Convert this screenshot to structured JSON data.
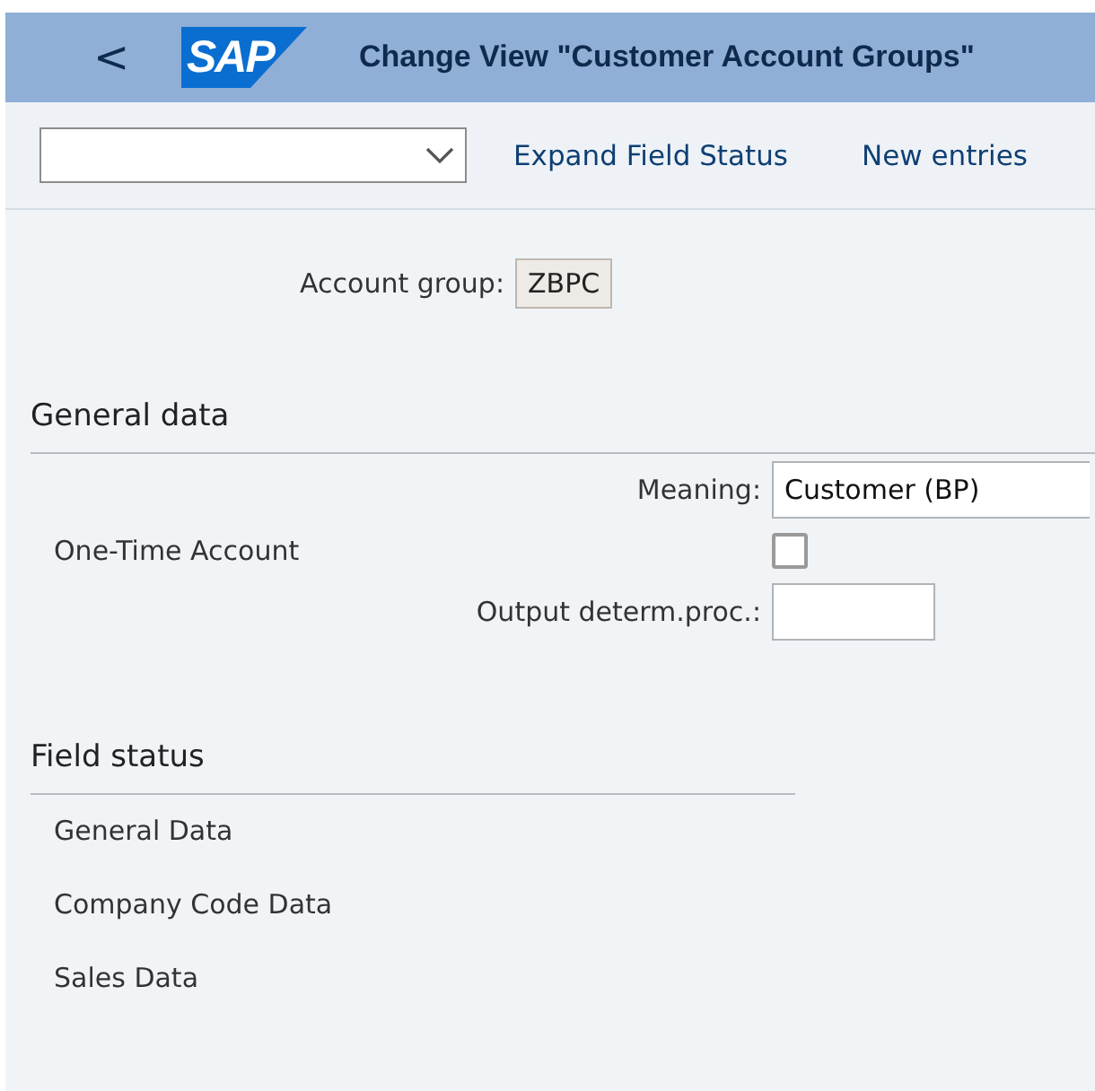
{
  "header": {
    "back": "<",
    "logo": "SAP",
    "title": "Change View \"Customer Account Groups\""
  },
  "toolbar": {
    "actions": [
      "Expand Field Status",
      "New entries"
    ]
  },
  "account_group": {
    "label": "Account group:",
    "value": "ZBPC"
  },
  "general_data": {
    "title": "General data",
    "fields": [
      {
        "kind": "text",
        "label": "Meaning:",
        "value": "Customer (BP)"
      },
      {
        "kind": "checkbox",
        "label": "One-Time Account",
        "checked": false
      },
      {
        "kind": "text",
        "label": "Output determ.proc.:"
      }
    ]
  },
  "field_status": {
    "title": "Field status",
    "items": [
      "General Data",
      "Company Code Data",
      "Sales Data"
    ]
  }
}
